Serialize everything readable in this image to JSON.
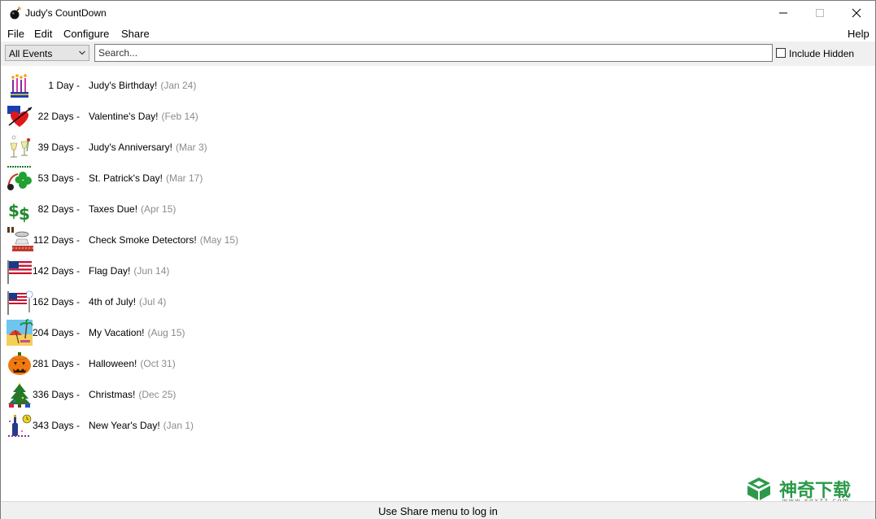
{
  "window": {
    "title": "Judy's CountDown"
  },
  "menu": {
    "file": "File",
    "edit": "Edit",
    "configure": "Configure",
    "share": "Share",
    "help": "Help"
  },
  "toolbar": {
    "filter_value": "All Events",
    "search_placeholder": "Search...",
    "include_hidden_label": "Include Hidden",
    "include_hidden_checked": false
  },
  "events": [
    {
      "days": "1 Day -",
      "name": "Judy's Birthday!",
      "date": "(Jan 24)",
      "icon": "birthday-candles-icon"
    },
    {
      "days": "22 Days -",
      "name": "Valentine's Day!",
      "date": "(Feb 14)",
      "icon": "heart-arrow-icon"
    },
    {
      "days": "39 Days -",
      "name": "Judy's Anniversary!",
      "date": "(Mar 3)",
      "icon": "champagne-glasses-icon"
    },
    {
      "days": "53 Days -",
      "name": "St. Patrick's Day!",
      "date": "(Mar 17)",
      "icon": "shamrock-icon"
    },
    {
      "days": "82 Days -",
      "name": "Taxes Due!",
      "date": "(Apr 15)",
      "icon": "dollar-sign-icon"
    },
    {
      "days": "112 Days -",
      "name": "Check Smoke Detectors!",
      "date": "(May 15)",
      "icon": "smoke-detector-icon"
    },
    {
      "days": "142 Days -",
      "name": "Flag Day!",
      "date": "(Jun 14)",
      "icon": "us-flag-icon"
    },
    {
      "days": "162 Days -",
      "name": "4th of July!",
      "date": "(Jul 4)",
      "icon": "flag-fireworks-icon"
    },
    {
      "days": "204 Days -",
      "name": "My Vacation!",
      "date": "(Aug 15)",
      "icon": "beach-umbrella-icon"
    },
    {
      "days": "281 Days -",
      "name": "Halloween!",
      "date": "(Oct 31)",
      "icon": "jack-o-lantern-icon"
    },
    {
      "days": "336 Days -",
      "name": "Christmas!",
      "date": "(Dec 25)",
      "icon": "christmas-tree-icon"
    },
    {
      "days": "343 Days -",
      "name": "New Year's Day!",
      "date": "(Jan 1)",
      "icon": "new-year-bottle-icon"
    }
  ],
  "status": {
    "text": "Use Share menu to log in"
  },
  "watermark": {
    "brand": "神奇下载",
    "url": "www.sqxzz.com"
  }
}
